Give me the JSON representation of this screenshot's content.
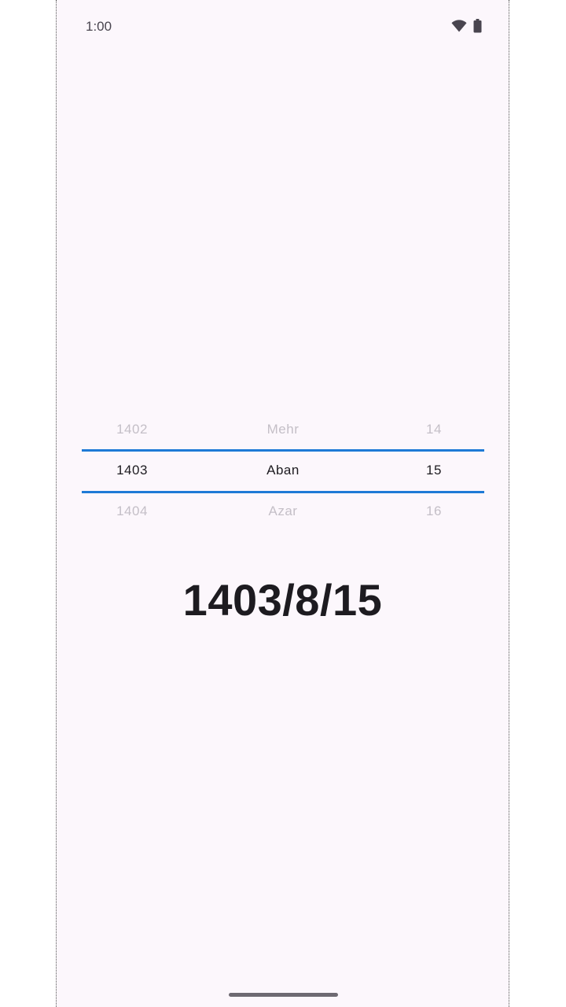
{
  "status_bar": {
    "time": "1:00",
    "icons": [
      "wifi-icon",
      "battery-icon"
    ]
  },
  "picker": {
    "year": {
      "prev": "1402",
      "selected": "1403",
      "next": "1404"
    },
    "month": {
      "prev": "Mehr",
      "selected": "Aban",
      "next": "Azar"
    },
    "day": {
      "prev": "14",
      "selected": "15",
      "next": "16"
    },
    "accent_color": "#1e7ad6"
  },
  "result": {
    "date": "1403/8/15"
  }
}
